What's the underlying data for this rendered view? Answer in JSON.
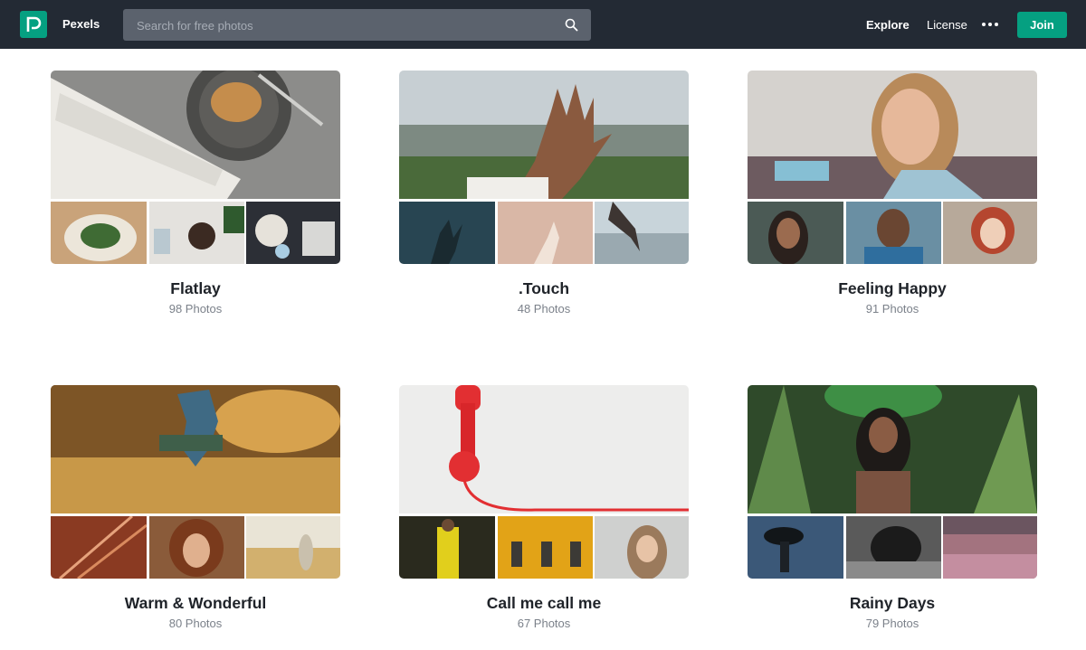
{
  "header": {
    "brand": "Pexels",
    "search_placeholder": "Search for free photos",
    "nav": {
      "explore": "Explore",
      "license": "License",
      "join": "Join"
    },
    "icons": {
      "logo": "pexels-logo-icon",
      "search": "search-icon",
      "more": "more-dots-icon"
    },
    "colors": {
      "bar": "#232a34",
      "accent": "#05a081"
    }
  },
  "collections": [
    {
      "title": "Flatlay",
      "count": "98 Photos"
    },
    {
      "title": ".Touch",
      "count": "48 Photos"
    },
    {
      "title": "Feeling Happy",
      "count": "91 Photos"
    },
    {
      "title": "Warm & Wonderful",
      "count": "80 Photos"
    },
    {
      "title": "Call me call me",
      "count": "67 Photos"
    },
    {
      "title": "Rainy Days",
      "count": "79 Photos"
    }
  ]
}
